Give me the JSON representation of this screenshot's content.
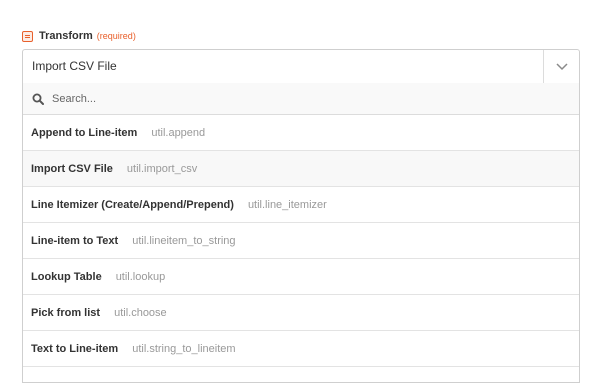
{
  "field": {
    "label": "Transform",
    "required": "(required)",
    "icon": "formatter-icon",
    "accent_color": "#e8602c"
  },
  "select": {
    "selected_value": "Import CSV File",
    "toggle_icon": "chevron-down-icon"
  },
  "search": {
    "placeholder": "Search...",
    "icon": "search-icon",
    "value": ""
  },
  "options": [
    {
      "name": "Append to Line-item",
      "key": "util.append"
    },
    {
      "name": "Import CSV File",
      "key": "util.import_csv"
    },
    {
      "name": "Line Itemizer (Create/Append/Prepend)",
      "key": "util.line_itemizer"
    },
    {
      "name": "Line-item to Text",
      "key": "util.lineitem_to_string"
    },
    {
      "name": "Lookup Table",
      "key": "util.lookup"
    },
    {
      "name": "Pick from list",
      "key": "util.choose"
    },
    {
      "name": "Text to Line-item",
      "key": "util.string_to_lineitem"
    }
  ]
}
